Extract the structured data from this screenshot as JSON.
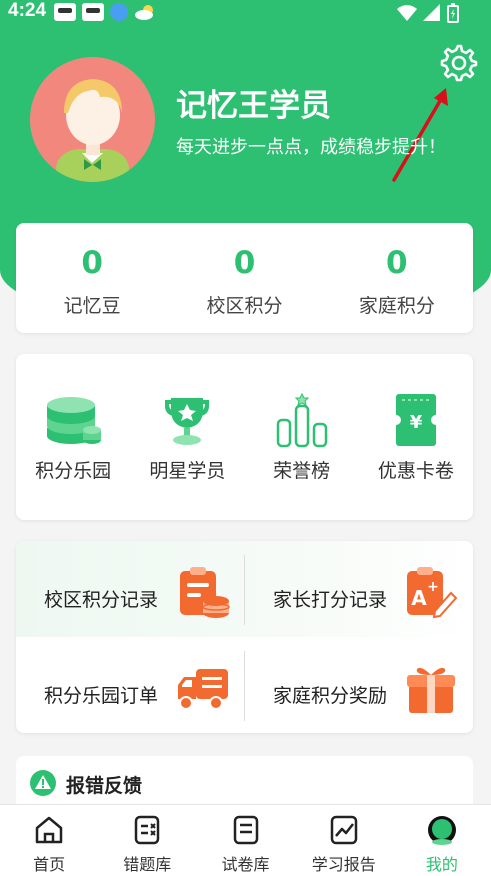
{
  "status": {
    "time": "4:24"
  },
  "profile": {
    "title": "记忆王学员",
    "subtitle": "每天进步一点点，成绩稳步提升！"
  },
  "stats": [
    {
      "value": "0",
      "label": "记忆豆"
    },
    {
      "value": "0",
      "label": "校区积分"
    },
    {
      "value": "0",
      "label": "家庭积分"
    }
  ],
  "features": [
    {
      "label": "积分乐园",
      "icon": "coins-icon"
    },
    {
      "label": "明星学员",
      "icon": "trophy-icon"
    },
    {
      "label": "荣誉榜",
      "icon": "podium-icon"
    },
    {
      "label": "优惠卡卷",
      "icon": "coupon-icon"
    }
  ],
  "records": [
    {
      "label": "校区积分记录",
      "icon": "clipboard-coins-icon"
    },
    {
      "label": "家长打分记录",
      "icon": "grade-edit-icon"
    },
    {
      "label": "积分乐园订单",
      "icon": "delivery-truck-icon"
    },
    {
      "label": "家庭积分奖励",
      "icon": "gift-icon"
    }
  ],
  "feedback": {
    "label": "报错反馈",
    "icon": "warning-icon"
  },
  "nav": [
    {
      "label": "首页",
      "icon": "home-icon"
    },
    {
      "label": "错题库",
      "icon": "wrong-questions-icon"
    },
    {
      "label": "试卷库",
      "icon": "paper-icon"
    },
    {
      "label": "学习报告",
      "icon": "report-chart-icon"
    },
    {
      "label": "我的",
      "icon": "profile-icon",
      "active": true
    }
  ],
  "colors": {
    "primary": "#2ec072",
    "orange": "#f26a30",
    "annotation": "#d8101a"
  }
}
